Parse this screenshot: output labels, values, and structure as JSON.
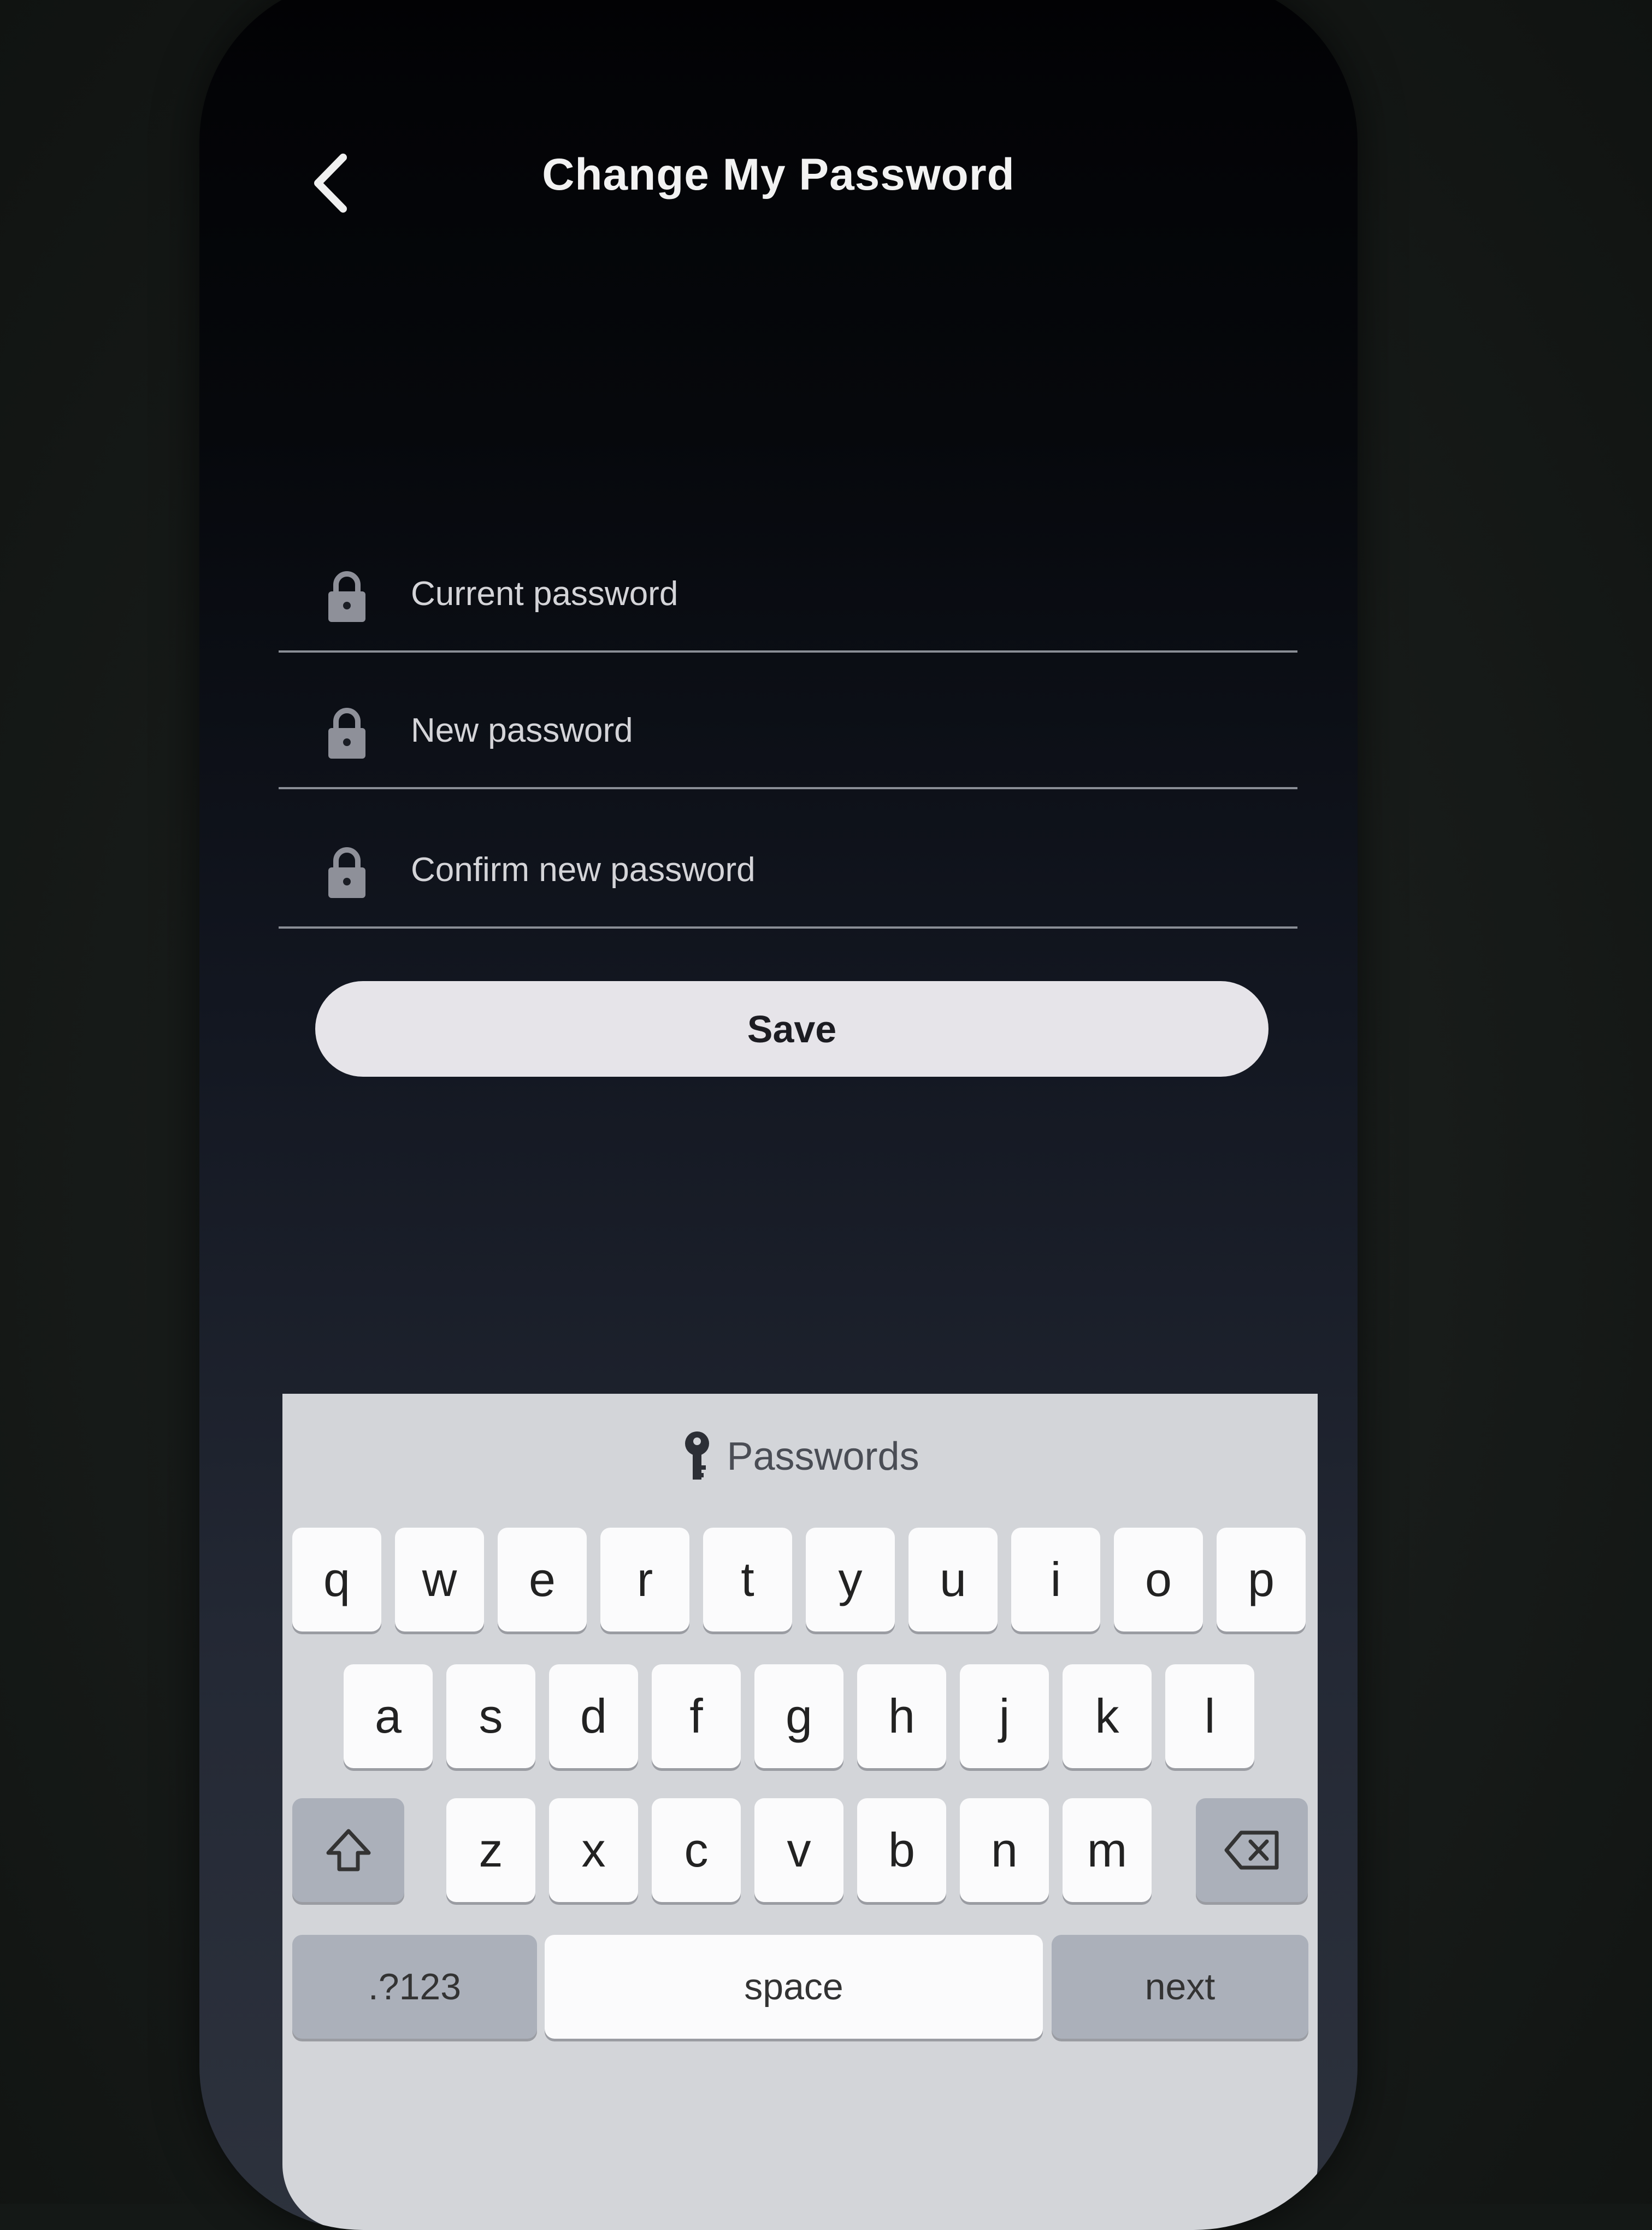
{
  "header": {
    "title": "Change My Password",
    "back_icon": "chevron-left-icon"
  },
  "form": {
    "current_password": {
      "placeholder": "Current password",
      "value": "",
      "icon": "lock-icon"
    },
    "new_password": {
      "placeholder": "New password",
      "value": "",
      "icon": "lock-icon"
    },
    "confirm_password": {
      "placeholder": "Confirm new password",
      "value": "",
      "icon": "lock-icon"
    },
    "save_label": "Save"
  },
  "keyboard": {
    "suggestion_label": "Passwords",
    "suggestion_icon": "key-icon",
    "rows": [
      [
        "q",
        "w",
        "e",
        "r",
        "t",
        "y",
        "u",
        "i",
        "o",
        "p"
      ],
      [
        "a",
        "s",
        "d",
        "f",
        "g",
        "h",
        "j",
        "k",
        "l"
      ],
      [
        "z",
        "x",
        "c",
        "v",
        "b",
        "n",
        "m"
      ]
    ],
    "shift_icon": "shift-icon",
    "backspace_icon": "backspace-icon",
    "numbers_label": ".?123",
    "space_label": "space",
    "next_label": "next"
  },
  "colors": {
    "screen_background": "#06080c",
    "save_button": "#e6e4e9",
    "keyboard_background": "#d3d5d9"
  }
}
